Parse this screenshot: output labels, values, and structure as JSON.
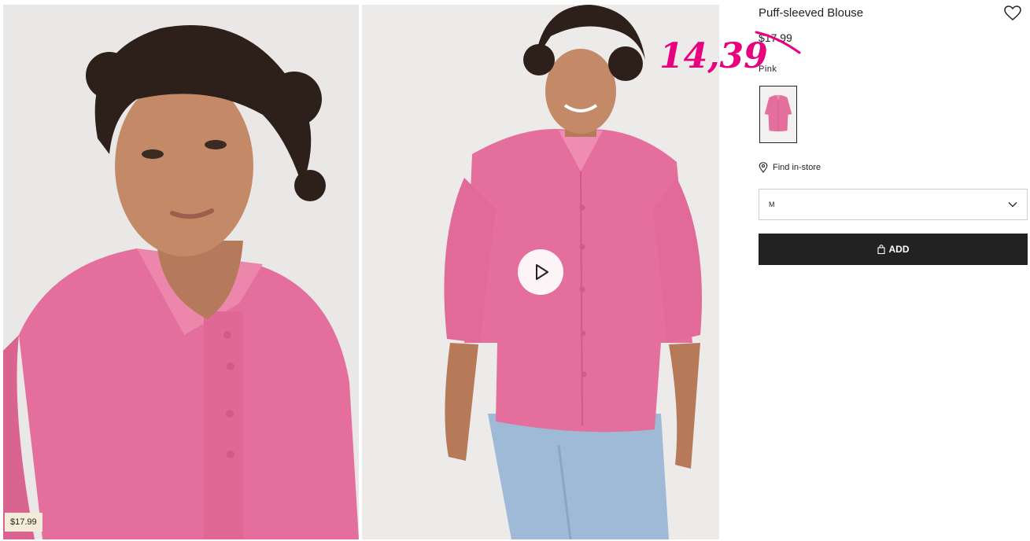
{
  "product": {
    "title": "Puff-sleeved Blouse",
    "original_price": "$17.99",
    "sale_price": "14,39",
    "color_label": "Pink",
    "find_in_store": "Find in-store",
    "selected_size": "M",
    "add_label": "ADD"
  },
  "gallery": {
    "price_chip": "$17.99"
  },
  "icons": {
    "favorite": "heart-icon",
    "location": "location-pin-icon",
    "dropdown": "chevron-down-icon",
    "bag": "shopping-bag-icon",
    "play": "play-icon"
  },
  "colors": {
    "accent_sale": "#e8007f",
    "blouse_pink": "#e56f9c",
    "add_button_bg": "#222222",
    "price_chip_bg": "#f4ecd8"
  }
}
